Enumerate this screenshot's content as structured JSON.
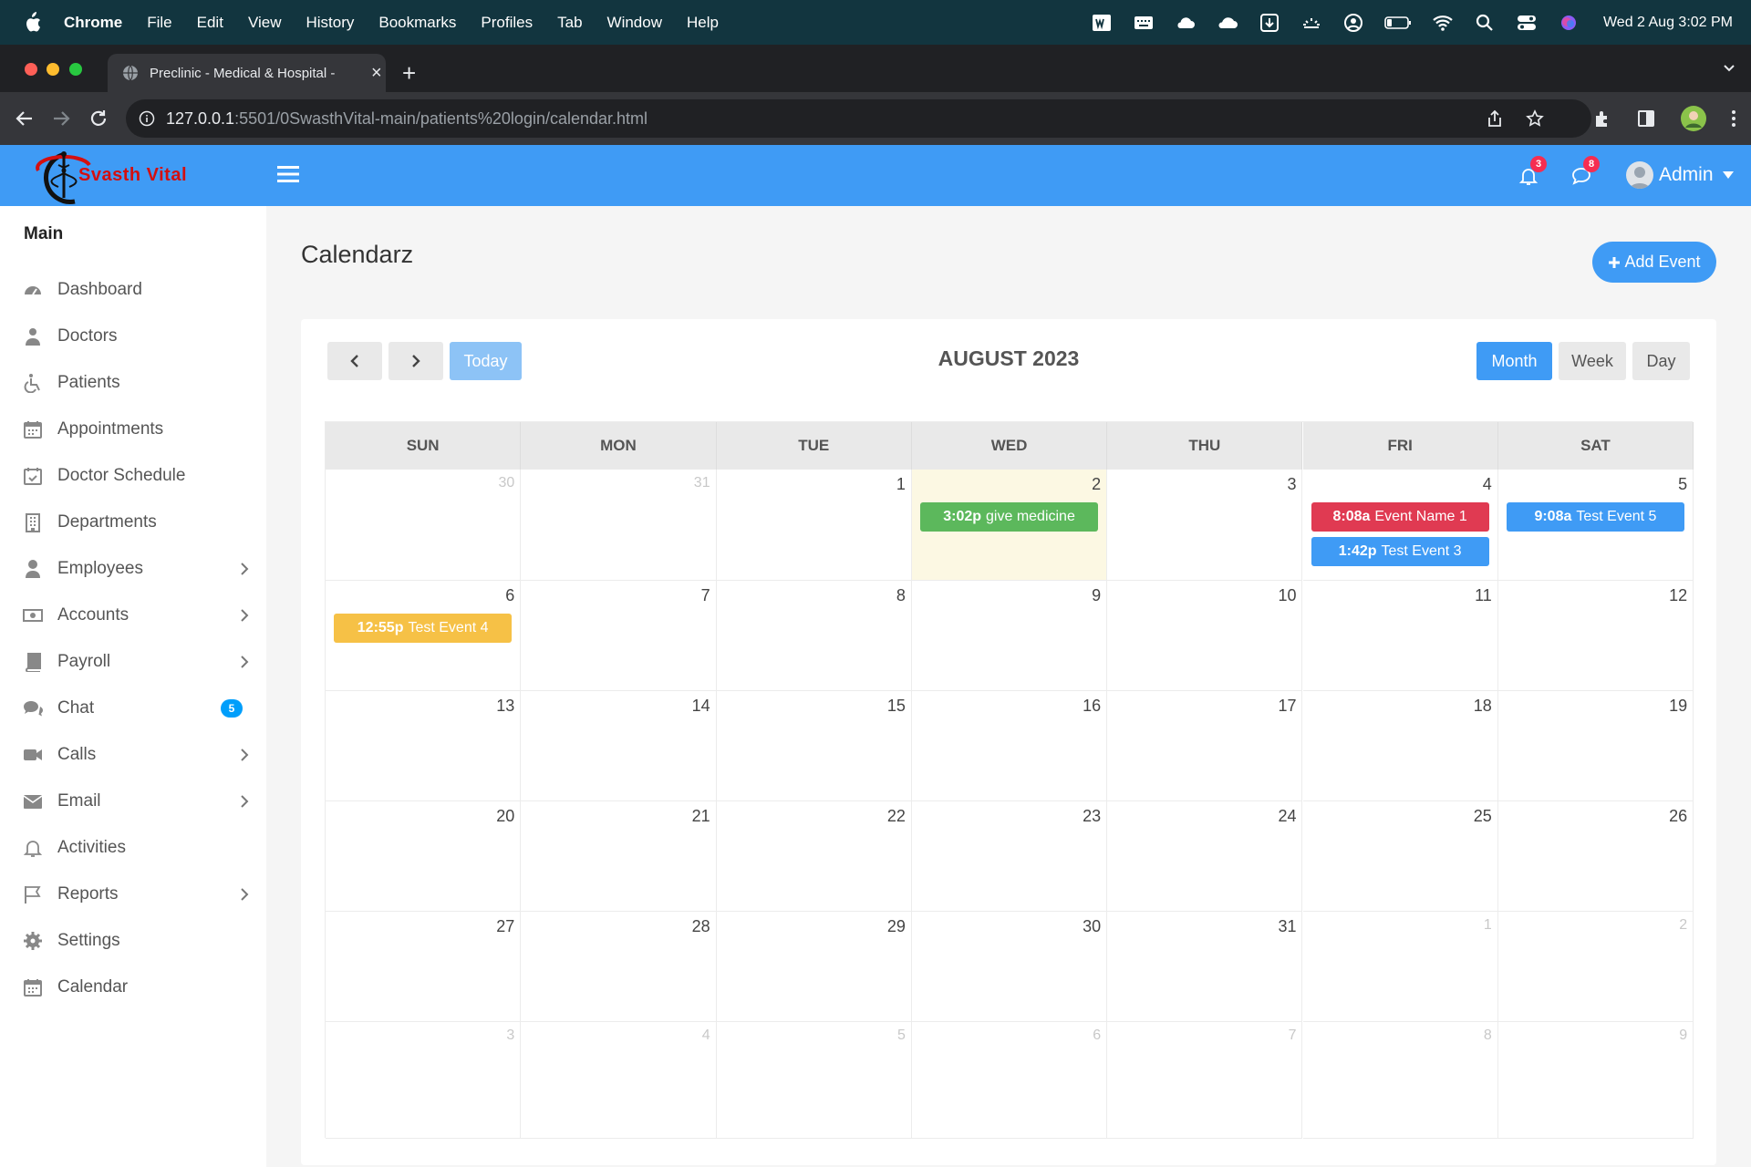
{
  "menubar": {
    "app": "Chrome",
    "items": [
      "File",
      "Edit",
      "View",
      "History",
      "Bookmarks",
      "Profiles",
      "Tab",
      "Window",
      "Help"
    ],
    "clock": "Wed 2 Aug  3:02 PM"
  },
  "browser": {
    "tab_title": "Preclinic - Medical & Hospital -",
    "url_host": "127.0.0.1",
    "url_path": ":5501/0SwasthVital-main/patients%20login/calendar.html"
  },
  "header": {
    "brand": "Svasth Vital",
    "notifications_count": "3",
    "messages_count": "8",
    "user": "Admin"
  },
  "sidebar": {
    "section": "Main",
    "items": [
      {
        "label": "Dashboard",
        "icon": "dashboard-icon"
      },
      {
        "label": "Doctors",
        "icon": "doctor-icon"
      },
      {
        "label": "Patients",
        "icon": "wheelchair-icon"
      },
      {
        "label": "Appointments",
        "icon": "calendar-icon"
      },
      {
        "label": "Doctor Schedule",
        "icon": "calendar-check-icon"
      },
      {
        "label": "Departments",
        "icon": "building-icon"
      },
      {
        "label": "Employees",
        "icon": "user-icon"
      },
      {
        "label": "Accounts",
        "icon": "money-icon"
      },
      {
        "label": "Payroll",
        "icon": "book-icon"
      },
      {
        "label": "Chat",
        "icon": "comments-icon",
        "badge": "5"
      },
      {
        "label": "Calls",
        "icon": "video-icon"
      },
      {
        "label": "Email",
        "icon": "envelope-icon"
      },
      {
        "label": "Activities",
        "icon": "bell-icon"
      },
      {
        "label": "Reports",
        "icon": "flag-icon"
      },
      {
        "label": "Settings",
        "icon": "cog-icon"
      },
      {
        "label": "Calendar",
        "icon": "calendar-icon"
      }
    ]
  },
  "page": {
    "title": "Calendarz",
    "add_event": "Add Event"
  },
  "calendar": {
    "title": "AUGUST 2023",
    "today_label": "Today",
    "views": [
      "Month",
      "Week",
      "Day"
    ],
    "active_view": "Month",
    "weekdays": [
      "SUN",
      "MON",
      "TUE",
      "WED",
      "THU",
      "FRI",
      "SAT"
    ],
    "weeks": [
      [
        "30",
        "31",
        "1",
        "2",
        "3",
        "4",
        "5"
      ],
      [
        "6",
        "7",
        "8",
        "9",
        "10",
        "11",
        "12"
      ],
      [
        "13",
        "14",
        "15",
        "16",
        "17",
        "18",
        "19"
      ],
      [
        "20",
        "21",
        "22",
        "23",
        "24",
        "25",
        "26"
      ],
      [
        "27",
        "28",
        "29",
        "30",
        "31",
        "1",
        "2"
      ],
      [
        "3",
        "4",
        "5",
        "6",
        "7",
        "8",
        "9"
      ]
    ],
    "today": "2",
    "events": [
      {
        "time": "3:02p",
        "title": "give medicine",
        "day": "2",
        "color": "#5cb85c"
      },
      {
        "time": "8:08a",
        "title": "Event Name 1",
        "day": "4",
        "color": "#e03a52"
      },
      {
        "time": "1:42p",
        "title": "Test Event 3",
        "day": "4",
        "color": "#3f9bf5"
      },
      {
        "time": "9:08a",
        "title": "Test Event 5",
        "day": "5",
        "color": "#3f9bf5"
      },
      {
        "time": "12:55p",
        "title": "Test Event 4",
        "day": "6",
        "color": "#f6c146"
      }
    ]
  },
  "colors": {
    "header_blue": "#3f9bf5",
    "today_bg": "#fcf8e3",
    "badge_red": "#f62d51",
    "badge_blue": "#009efb"
  }
}
